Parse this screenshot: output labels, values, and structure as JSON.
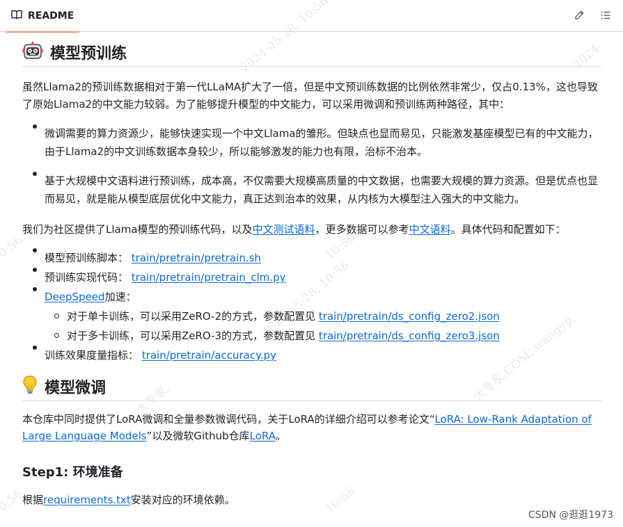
{
  "header": {
    "tab_label": "README"
  },
  "section1": {
    "title": "模型预训练",
    "intro": "虽然Llama2的预训练数据相对于第一代LLaMA扩大了一倍，但是中文预训练数据的比例依然非常少，仅占0.13%，这也导致了原始Llama2的中文能力较弱。为了能够提升模型的中文能力，可以采用微调和预训练两种路径，其中：",
    "bullets": [
      "微调需要的算力资源少，能够快速实现一个中文Llama的雏形。但缺点也显而易见，只能激发基座模型已有的中文能力，由于Llama2的中文训练数据本身较少，所以能够激发的能力也有限，治标不治本。",
      "基于大规模中文语料进行预训练，成本高，不仅需要大规模高质量的中文数据，也需要大规模的算力资源。但是优点也显而易见，就是能从模型底层优化中文能力，真正达到治本的效果，从内核为大模型注入强大的中文能力。"
    ],
    "para2": {
      "pre": "我们为社区提供了Llama模型的预训练代码，以及",
      "link1": "中文测试语料",
      "mid": "，更多数据可以参考",
      "link2": "中文语料",
      "post": "。具体代码和配置如下："
    },
    "items": {
      "script_label": "模型预训练脚本：",
      "script_link": "train/pretrain/pretrain.sh",
      "code_label": "预训练实现代码：",
      "code_link": "train/pretrain/pretrain_clm.py",
      "ds_link": "DeepSpeed",
      "ds_label": "加速：",
      "single_label": "对于单卡训练，可以采用ZeRO-2的方式，参数配置见 ",
      "single_link": "train/pretrain/ds_config_zero2.json",
      "multi_label": "对于多卡训练，可以采用ZeRO-3的方式，参数配置见 ",
      "multi_link": "train/pretrain/ds_config_zero3.json",
      "metric_label": "训练效果度量指标：",
      "metric_link": "train/pretrain/accuracy.py"
    }
  },
  "section2": {
    "title": "模型微调",
    "para": {
      "pre": "本仓库中同时提供了LoRA微调和全量参数微调代码，关于LoRA的详细介绍可以参考论文“",
      "link1": "LoRA: Low-Rank Adaptation of Large Language Models",
      "mid": "”以及微软Github仓库",
      "link2": "LoRA",
      "post": "。"
    },
    "step1_title": "Step1: 环境准备",
    "step1": {
      "pre": "根据",
      "link": "requirements.txt",
      "post": "安装对应的环境依赖。"
    }
  },
  "watermark": {
    "date": "2024-05-28, 10:56",
    "domain": "大专家.COM, wangyp,",
    "date_short": "2024-",
    "time_a": "10:56",
    "time_b": "10:56",
    "time_c": "0:56",
    "expert": "大专家."
  },
  "credit": "CSDN @逛逛1973",
  "colors": {
    "link": "#0969da",
    "tab_underline": "#fd8c73",
    "text": "#1f2328"
  }
}
